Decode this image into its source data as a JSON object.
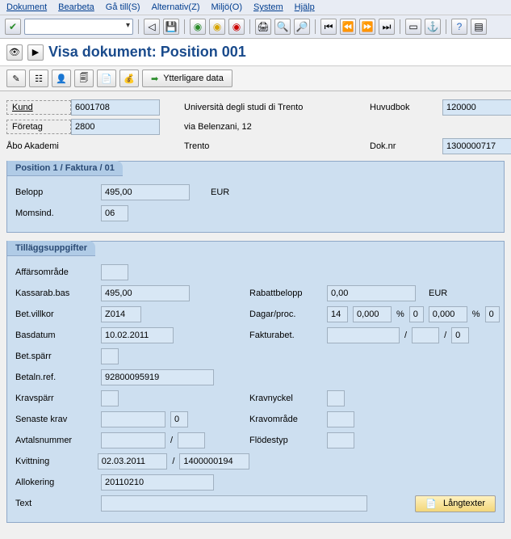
{
  "menu": {
    "dokument": "Dokument",
    "bearbeta": "Bearbeta",
    "ga_till": "Gå till(S)",
    "alternativ": "Alternativ(Z)",
    "miljo": "Miljö(O)",
    "system": "System",
    "hjalp": "Hjälp"
  },
  "page_title": "Visa dokument: Position 001",
  "toolbar2": {
    "ytterligare": "Ytterligare data"
  },
  "header": {
    "kund_label": "Kund",
    "kund_value": "6001708",
    "foretag_label": "Företag",
    "foretag_value": "2800",
    "entity_name": "Università degli studi di Trento",
    "street": "via Belenzani, 12",
    "city": "Trento",
    "company": "Åbo Akademi",
    "huvudbok_label": "Huvudbok",
    "huvudbok_value": "120000",
    "doknr_label": "Dok.nr",
    "doknr_value": "1300000717"
  },
  "position": {
    "tab": "Position 1 / Faktura / 01",
    "belopp_label": "Belopp",
    "belopp_value": "495,00",
    "currency": "EUR",
    "momsind_label": "Momsind.",
    "momsind_value": "06"
  },
  "tillagg": {
    "tab": "Tilläggsuppgifter",
    "affarsomrade_label": "Affärsområde",
    "affarsomrade_value": "",
    "kassarab_label": "Kassarab.bas",
    "kassarab_value": "495,00",
    "betvillkor_label": "Bet.villkor",
    "betvillkor_value": "Z014",
    "basdatum_label": "Basdatum",
    "basdatum_value": "10.02.2011",
    "betsparr_label": "Bet.spärr",
    "betsparr_value": "",
    "betalref_label": "Betaln.ref.",
    "betalref_value": "92800095919",
    "kravsparr_label": "Kravspärr",
    "kravsparr_value": "",
    "senaste_label": "Senaste krav",
    "senaste_value": "",
    "senaste_count": "0",
    "avtal_label": "Avtalsnummer",
    "avtal_v1": "",
    "avtal_v2": "",
    "kvittning_label": "Kvittning",
    "kvittning_date": "02.03.2011",
    "kvittning_doc": "1400000194",
    "allokering_label": "Allokering",
    "allokering_value": "20110210",
    "text_label": "Text",
    "text_value": "",
    "rabatt_label": "Rabattbelopp",
    "rabatt_value": "0,00",
    "rabatt_curr": "EUR",
    "dagar_label": "Dagar/proc.",
    "dagar_d1": "14",
    "dagar_p1": "0,000",
    "pct": "%",
    "dagar_d2": "0",
    "dagar_p2": "0,000",
    "dagar_d3": "0",
    "faktura_label": "Fakturabet.",
    "faktura_v1": "",
    "slash": "/",
    "faktura_v2": "",
    "faktura_v3": "0",
    "kravnyckel_label": "Kravnyckel",
    "kravnyckel_value": "",
    "kravomrade_label": "Kravområde",
    "kravomrade_value": "",
    "flodestyp_label": "Flödestyp",
    "flodestyp_value": "",
    "langtexter": "Långtexter"
  }
}
